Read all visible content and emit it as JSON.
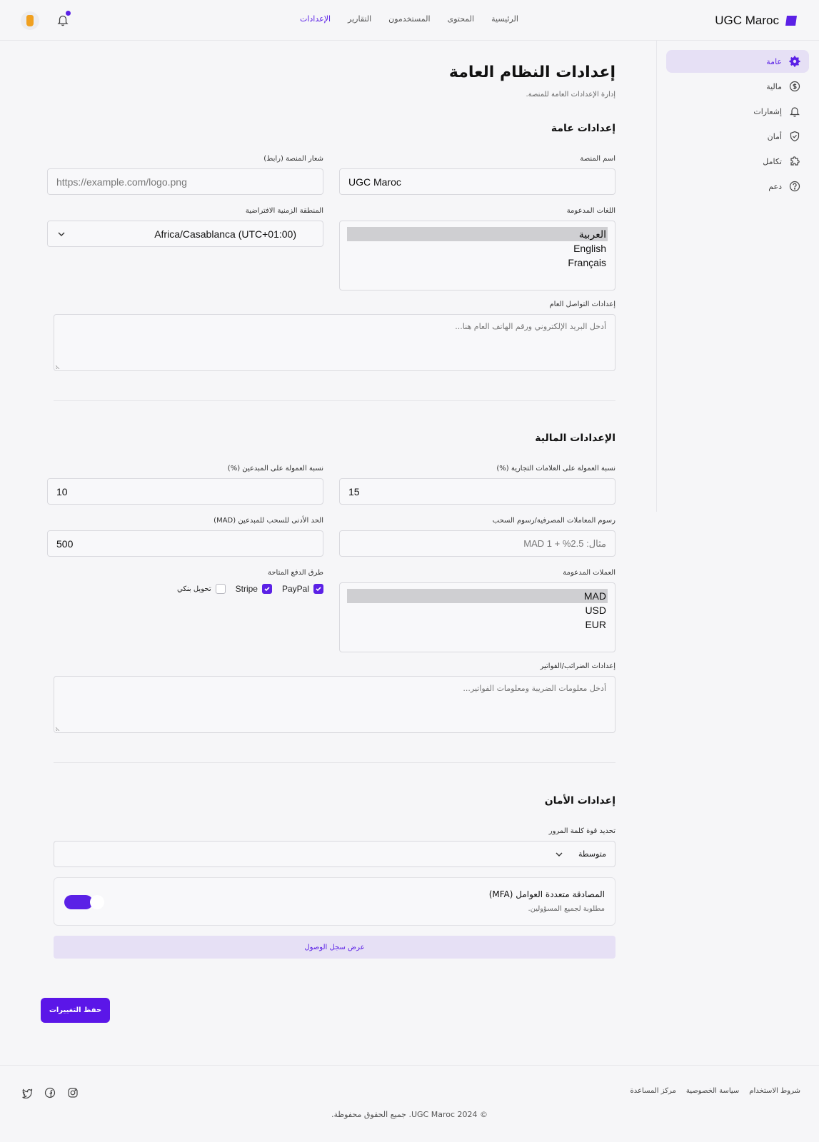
{
  "header": {
    "brand": "UGC Maroc",
    "nav": [
      "الرئيسية",
      "المحتوى",
      "المستخدمون",
      "التقارير",
      "الإعدادات"
    ],
    "active_nav": "الإعدادات"
  },
  "sidebar": {
    "items": [
      {
        "label": "عامة",
        "icon": "gear-icon",
        "active": true
      },
      {
        "label": "مالية",
        "icon": "dollar-icon",
        "active": false
      },
      {
        "label": "إشعارات",
        "icon": "bell-icon",
        "active": false
      },
      {
        "label": "أمان",
        "icon": "shield-icon",
        "active": false
      },
      {
        "label": "تكامل",
        "icon": "puzzle-icon",
        "active": false
      },
      {
        "label": "دعم",
        "icon": "help-icon",
        "active": false
      }
    ]
  },
  "page": {
    "title": "إعدادات النظام العامة",
    "subtitle": "إدارة الإعدادات العامة للمنصة."
  },
  "general": {
    "title": "إعدادات عامة",
    "platform_name_label": "اسم المنصة",
    "platform_name_value": "UGC Maroc",
    "logo_label": "شعار المنصة (رابط)",
    "logo_placeholder": "https://example.com/logo.png",
    "languages_label": "اللغات المدعومة",
    "languages": [
      "العربية",
      "English",
      "Français"
    ],
    "timezone_label": "المنطقة الزمنية الافتراضية",
    "timezone_value": "Africa/Casablanca (UTC+01:00)",
    "contact_label": "إعدادات التواصل العام",
    "contact_placeholder": "أدخل البريد الإلكتروني ورقم الهاتف العام هنا..."
  },
  "financial": {
    "title": "الإعدادات المالية",
    "brand_commission_label": "نسبة العمولة على العلامات التجارية (%)",
    "brand_commission_value": "15",
    "creator_commission_label": "نسبة العمولة على المبدعين (%)",
    "creator_commission_value": "10",
    "bank_fees_label": "رسوم المعاملات المصرفية/رسوم السحب",
    "bank_fees_placeholder": "مثال: 2.5% + 1 MAD",
    "min_withdrawal_label": "الحد الأدنى للسحب للمبدعين (MAD)",
    "min_withdrawal_value": "500",
    "currencies_label": "العملات المدعومة",
    "currencies": [
      "MAD",
      "USD",
      "EUR"
    ],
    "payment_methods_label": "طرق الدفع المتاحة",
    "payment_methods": [
      {
        "label": "PayPal",
        "checked": true
      },
      {
        "label": "Stripe",
        "checked": true
      },
      {
        "label": "تحويل بنكي",
        "checked": false
      }
    ],
    "tax_label": "إعدادات الضرائب/الفواتير",
    "tax_placeholder": "أدخل معلومات الضريبة ومعلومات الفواتير..."
  },
  "security": {
    "title": "إعدادات الأمان",
    "password_label": "تحديد قوة كلمة المرور",
    "password_value": "متوسطة",
    "mfa_title": "المصادقة متعددة العوامل (MFA)",
    "mfa_sub": "مطلوبة لجميع المسؤولين.",
    "mfa_enabled": true,
    "log_button": "عرض سجل الوصول"
  },
  "actions": {
    "save": "حفظ التغييرات"
  },
  "footer": {
    "links": [
      "شروط الاستخدام",
      "سياسة الخصوصية",
      "مركز المساعدة"
    ],
    "copyright": "© 2024 UGC Maroc. جميع الحقوق محفوظة.",
    "socials": [
      "twitter-icon",
      "facebook-icon",
      "instagram-icon"
    ]
  },
  "colors": {
    "accent": "#5b21e6",
    "accent_light": "#e6e0f5",
    "background": "#f6f6f8"
  }
}
